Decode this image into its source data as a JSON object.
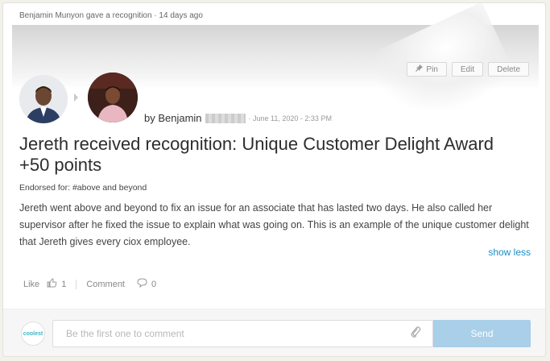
{
  "feed_header": "Benjamin Munyon gave a recognition · 14 days ago",
  "actions": {
    "pin": "Pin",
    "edit": "Edit",
    "delete": "Delete"
  },
  "byline": {
    "prefix": "by Benjamin",
    "date": "· June 11, 2020 - 2:33 PM"
  },
  "title": "Jereth received recognition: Unique Customer Delight Award +50 points",
  "endorsed": {
    "label": "Endorsed for:",
    "value": "#above and beyond"
  },
  "body": "Jereth went above and beyond to fix an issue for an associate that has lasted two days. He also called her supervisor after he fixed the issue to explain what was going on. This is an example of the unique customer delight that Jereth gives every ciox employee.",
  "show_less": "show less",
  "social": {
    "like_label": "Like",
    "like_count": "1",
    "comment_label": "Comment",
    "comment_count": "0"
  },
  "footer": {
    "logo_text": "coolest",
    "comment_placeholder": "Be the first one to comment",
    "send_label": "Send"
  },
  "colors": {
    "link": "#1a8fc9",
    "send_button": "#a9cfe9"
  }
}
